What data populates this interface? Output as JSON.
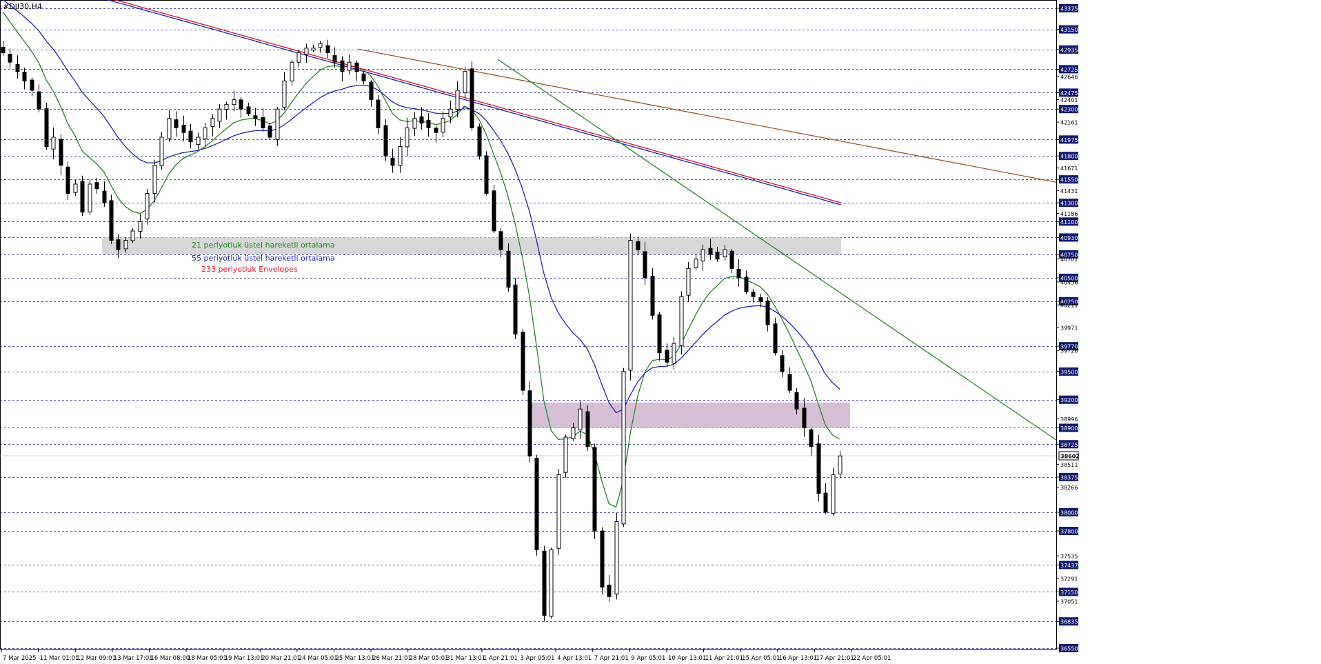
{
  "symbol_label": "#DJI30,H4",
  "legend": [
    {
      "text": "21 periyotluk üstel hareketli ortalama",
      "color": "#1a8a1a"
    },
    {
      "text": "55 periyotluk üstel hareketli ortalama",
      "color": "#1f1fb8"
    },
    {
      "text": "233 periyotluk Envelopes",
      "color": "#d8102a"
    }
  ],
  "chart_data": {
    "type": "candlestick",
    "ylim": [
      36550,
      43375
    ],
    "price_levels_dashed": [
      43375,
      43150,
      42935,
      42725,
      42475,
      42300,
      41975,
      41800,
      41550,
      41300,
      41100,
      40930,
      40750,
      40500,
      40250,
      39770,
      39500,
      39200,
      38900,
      38725,
      38375,
      38000,
      37800,
      37437,
      37150,
      36835,
      36550
    ],
    "price_levels_plain": [
      42646,
      42401,
      42161,
      41671,
      41431,
      41186,
      40701,
      40456,
      40211,
      39971,
      39726,
      38996,
      38511,
      38266,
      37535,
      37291,
      37051
    ],
    "current_price": 38602,
    "x_labels": [
      "7 Mar 2025",
      "11 Mar 01:01",
      "12 Mar 09:01",
      "13 Mar 17:01",
      "16 Mar 08:00",
      "18 Mar 05:01",
      "19 Mar 13:01",
      "20 Mar 21:01",
      "24 Mar 05:01",
      "25 Mar 13:01",
      "26 Mar 21:01",
      "28 Mar 05:01",
      "31 Mar 13:01",
      "1 Apr 21:01",
      "3 Apr 05:01",
      "4 Apr 13:01",
      "7 Apr 21:01",
      "9 Apr 05:01",
      "10 Apr 13:01",
      "11 Apr 21:01",
      "15 Apr 05:01",
      "16 Apr 13:01",
      "17 Apr 21:01",
      "22 Apr 05:01"
    ],
    "close_path": [
      42900,
      42800,
      42700,
      42600,
      42500,
      42300,
      41900,
      42000,
      41700,
      41400,
      41500,
      41200,
      41500,
      41450,
      41300,
      40900,
      40800,
      40900,
      41000,
      41100,
      41400,
      41700,
      42000,
      42200,
      42100,
      42050,
      41950,
      42000,
      42100,
      42200,
      42300,
      42350,
      42400,
      42300,
      42250,
      42200,
      42100,
      42000,
      42300,
      42600,
      42800,
      42900,
      42950,
      42950,
      43000,
      42900,
      42800,
      42700,
      42800,
      42700,
      42600,
      42400,
      42100,
      41800,
      41700,
      41900,
      42100,
      42200,
      42150,
      42100,
      42050,
      42200,
      42300,
      42500,
      42700,
      42100,
      41800,
      41400,
      41000,
      40800,
      40400,
      39900,
      39300,
      38600,
      37600,
      36900,
      37600,
      38400,
      38800,
      38900,
      39100,
      38700,
      37800,
      37200,
      37100,
      37900,
      39500,
      40900,
      40800,
      40500,
      40100,
      39700,
      39600,
      39800,
      40300,
      40600,
      40700,
      40800,
      40750,
      40700,
      40800,
      40600,
      40500,
      40350,
      40300,
      40250,
      40000,
      39700,
      39500,
      39300,
      39100,
      38900,
      38700,
      38200,
      38000,
      38400,
      38600
    ]
  },
  "zones": [
    {
      "from": 40750,
      "to": 40930,
      "color": "#d7d7d7"
    },
    {
      "from": 38900,
      "to": 39170,
      "color": "#d8bfd8"
    }
  ],
  "trendlines": [
    {
      "p1": [
        519,
        42940
      ],
      "p2": [
        1532,
        41520
      ],
      "color": "#a0522d"
    },
    {
      "p1": [
        722,
        42830
      ],
      "p2": [
        1532,
        38770
      ],
      "color": "#1e8b1e"
    }
  ],
  "current_price_label": "38602"
}
